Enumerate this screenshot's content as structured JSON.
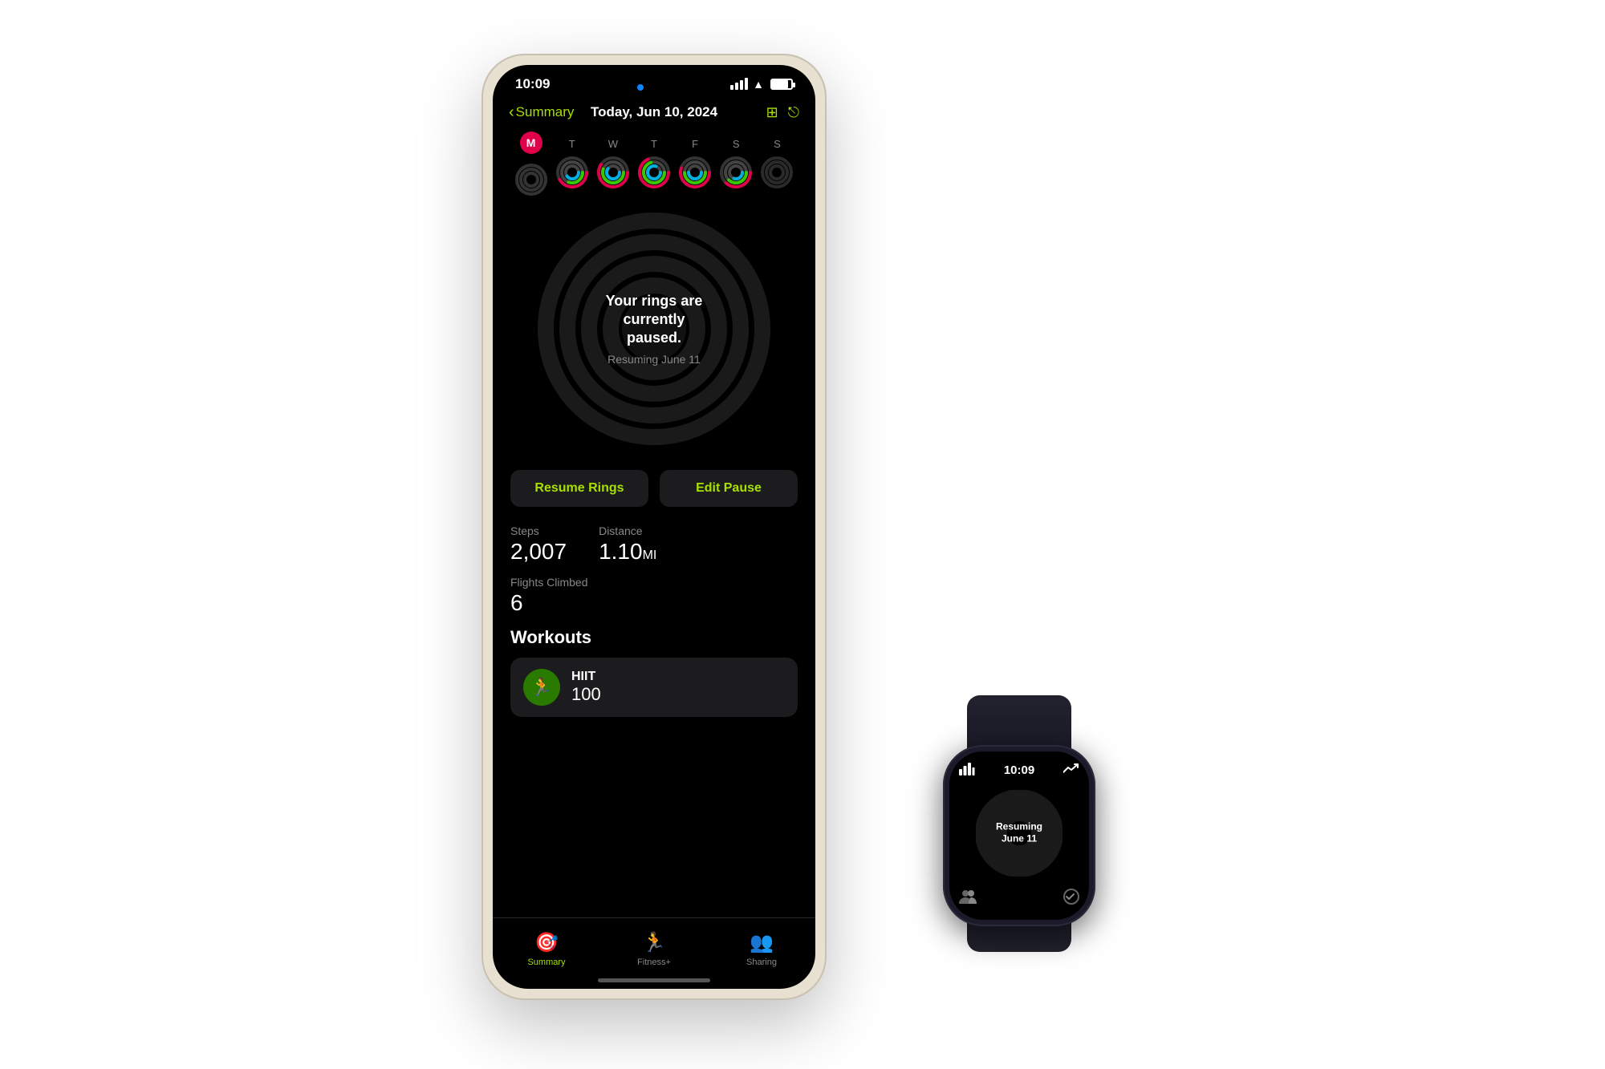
{
  "scene": {
    "background": "#ffffff"
  },
  "iphone": {
    "statusBar": {
      "time": "10:09",
      "bluetooth": true
    },
    "nav": {
      "backLabel": "Summary",
      "centerTitle": "Today, Jun 10, 2024"
    },
    "weekDays": [
      {
        "label": "M",
        "type": "badge"
      },
      {
        "label": "T",
        "type": "ring"
      },
      {
        "label": "W",
        "type": "ring"
      },
      {
        "label": "T",
        "type": "ring"
      },
      {
        "label": "F",
        "type": "ring"
      },
      {
        "label": "S",
        "type": "ring"
      },
      {
        "label": "S",
        "type": "ring"
      }
    ],
    "ringStatus": {
      "headline": "Your rings are currently paused.",
      "subtext": "Resuming June 11"
    },
    "buttons": {
      "resume": "Resume Rings",
      "editPause": "Edit Pause"
    },
    "stats": {
      "steps": {
        "label": "Steps",
        "value": "2,007"
      },
      "distance": {
        "label": "Distance",
        "value": "1.10",
        "unit": "MI"
      },
      "flightsClimbed": {
        "label": "Flights Climbed",
        "value": "6"
      }
    },
    "workouts": {
      "title": "Workouts",
      "items": [
        {
          "name": "HIIT",
          "value": "100"
        }
      ]
    },
    "tabBar": {
      "tabs": [
        {
          "label": "Summary",
          "active": true,
          "icon": "🎯"
        },
        {
          "label": "Fitness+",
          "active": false,
          "icon": "🏃"
        },
        {
          "label": "Sharing",
          "active": false,
          "icon": "👥"
        }
      ]
    }
  },
  "appleWatch": {
    "time": "10:09",
    "ringText": "Resuming June 11",
    "icons": {
      "topLeft": "bar-chart",
      "topRight": "trending-up",
      "bottomLeft": "people",
      "bottomRight": "activity"
    }
  }
}
